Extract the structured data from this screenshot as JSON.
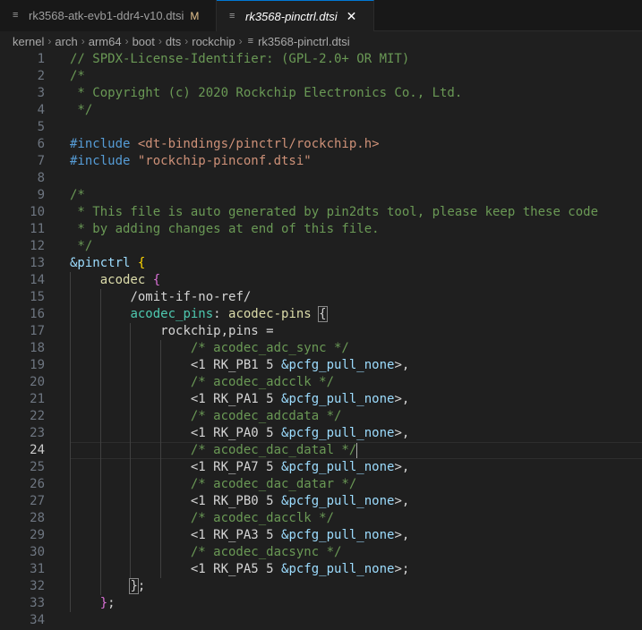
{
  "tabs": [
    {
      "label": "rk3568-atk-evb1-ddr4-v10.dtsi",
      "modified": "M",
      "icon": "lines-file-icon"
    },
    {
      "label": "rk3568-pinctrl.dtsi",
      "close": "✕",
      "icon": "lines-file-icon"
    }
  ],
  "breadcrumb": [
    "kernel",
    "arch",
    "arm64",
    "boot",
    "dts",
    "rockchip",
    "rk3568-pinctrl.dtsi"
  ],
  "line_numbers": [
    "1",
    "2",
    "3",
    "4",
    "5",
    "6",
    "7",
    "8",
    "9",
    "10",
    "11",
    "12",
    "13",
    "14",
    "15",
    "16",
    "17",
    "18",
    "19",
    "20",
    "21",
    "22",
    "23",
    "24",
    "25",
    "26",
    "27",
    "28",
    "29",
    "30",
    "31",
    "32",
    "33",
    "34"
  ],
  "current_line": "24",
  "code": [
    [
      [
        "c-comment",
        "// SPDX-License-Identifier: (GPL-2.0+ OR MIT)"
      ]
    ],
    [
      [
        "c-comment",
        "/*"
      ]
    ],
    [
      [
        "c-comment",
        " * Copyright (c) 2020 Rockchip Electronics Co., Ltd."
      ]
    ],
    [
      [
        "c-comment",
        " */"
      ]
    ],
    [],
    [
      [
        "c-kw",
        "#include "
      ],
      [
        "c-str",
        "<dt-bindings/pinctrl/rockchip.h>"
      ]
    ],
    [
      [
        "c-kw",
        "#include "
      ],
      [
        "c-str",
        "\"rockchip-pinconf.dtsi\""
      ]
    ],
    [],
    [
      [
        "c-comment",
        "/*"
      ]
    ],
    [
      [
        "c-comment",
        " * This file is auto generated by pin2dts tool, please keep these code"
      ]
    ],
    [
      [
        "c-comment",
        " * by adding changes at end of this file."
      ]
    ],
    [
      [
        "c-comment",
        " */"
      ]
    ],
    [
      [
        "c-ref",
        "&pinctrl"
      ],
      [
        "c-plain",
        " "
      ],
      [
        "c-brace",
        "{"
      ]
    ],
    [
      [
        "c-plain",
        "    "
      ],
      [
        "c-node",
        "acodec"
      ],
      [
        "c-plain",
        " "
      ],
      [
        "c-brace2",
        "{"
      ]
    ],
    [
      [
        "c-plain",
        "        "
      ],
      [
        "c-plain",
        "/omit-if-no-ref/"
      ]
    ],
    [
      [
        "c-plain",
        "        "
      ],
      [
        "c-label",
        "acodec_pins"
      ],
      [
        "c-plain",
        ": "
      ],
      [
        "c-node",
        "acodec-pins"
      ],
      [
        "c-plain",
        " "
      ],
      [
        "c-bracket-hl",
        "{"
      ]
    ],
    [
      [
        "c-plain",
        "            "
      ],
      [
        "c-plain",
        "rockchip,pins ="
      ]
    ],
    [
      [
        "c-plain",
        "                "
      ],
      [
        "c-comment",
        "/* acodec_adc_sync */"
      ]
    ],
    [
      [
        "c-plain",
        "                "
      ],
      [
        "c-plain",
        "<1 RK_PB1 5 "
      ],
      [
        "c-ref",
        "&pcfg_pull_none"
      ],
      [
        "c-plain",
        ">,"
      ]
    ],
    [
      [
        "c-plain",
        "                "
      ],
      [
        "c-comment",
        "/* acodec_adcclk */"
      ]
    ],
    [
      [
        "c-plain",
        "                "
      ],
      [
        "c-plain",
        "<1 RK_PA1 5 "
      ],
      [
        "c-ref",
        "&pcfg_pull_none"
      ],
      [
        "c-plain",
        ">,"
      ]
    ],
    [
      [
        "c-plain",
        "                "
      ],
      [
        "c-comment",
        "/* acodec_adcdata */"
      ]
    ],
    [
      [
        "c-plain",
        "                "
      ],
      [
        "c-plain",
        "<1 RK_PA0 5 "
      ],
      [
        "c-ref",
        "&pcfg_pull_none"
      ],
      [
        "c-plain",
        ">,"
      ]
    ],
    [
      [
        "c-plain",
        "                "
      ],
      [
        "c-comment",
        "/* acodec_dac_datal */"
      ],
      [
        "cursor",
        ""
      ]
    ],
    [
      [
        "c-plain",
        "                "
      ],
      [
        "c-plain",
        "<1 RK_PA7 5 "
      ],
      [
        "c-ref",
        "&pcfg_pull_none"
      ],
      [
        "c-plain",
        ">,"
      ]
    ],
    [
      [
        "c-plain",
        "                "
      ],
      [
        "c-comment",
        "/* acodec_dac_datar */"
      ]
    ],
    [
      [
        "c-plain",
        "                "
      ],
      [
        "c-plain",
        "<1 RK_PB0 5 "
      ],
      [
        "c-ref",
        "&pcfg_pull_none"
      ],
      [
        "c-plain",
        ">,"
      ]
    ],
    [
      [
        "c-plain",
        "                "
      ],
      [
        "c-comment",
        "/* acodec_dacclk */"
      ]
    ],
    [
      [
        "c-plain",
        "                "
      ],
      [
        "c-plain",
        "<1 RK_PA3 5 "
      ],
      [
        "c-ref",
        "&pcfg_pull_none"
      ],
      [
        "c-plain",
        ">,"
      ]
    ],
    [
      [
        "c-plain",
        "                "
      ],
      [
        "c-comment",
        "/* acodec_dacsync */"
      ]
    ],
    [
      [
        "c-plain",
        "                "
      ],
      [
        "c-plain",
        "<1 RK_PA5 5 "
      ],
      [
        "c-ref",
        "&pcfg_pull_none"
      ],
      [
        "c-plain",
        ">;"
      ]
    ],
    [
      [
        "c-plain",
        "        "
      ],
      [
        "c-bracket-hl",
        "}"
      ],
      [
        "c-plain",
        ";"
      ]
    ],
    [
      [
        "c-plain",
        "    "
      ],
      [
        "c-brace2",
        "}"
      ],
      [
        "c-plain",
        ";"
      ]
    ],
    []
  ]
}
